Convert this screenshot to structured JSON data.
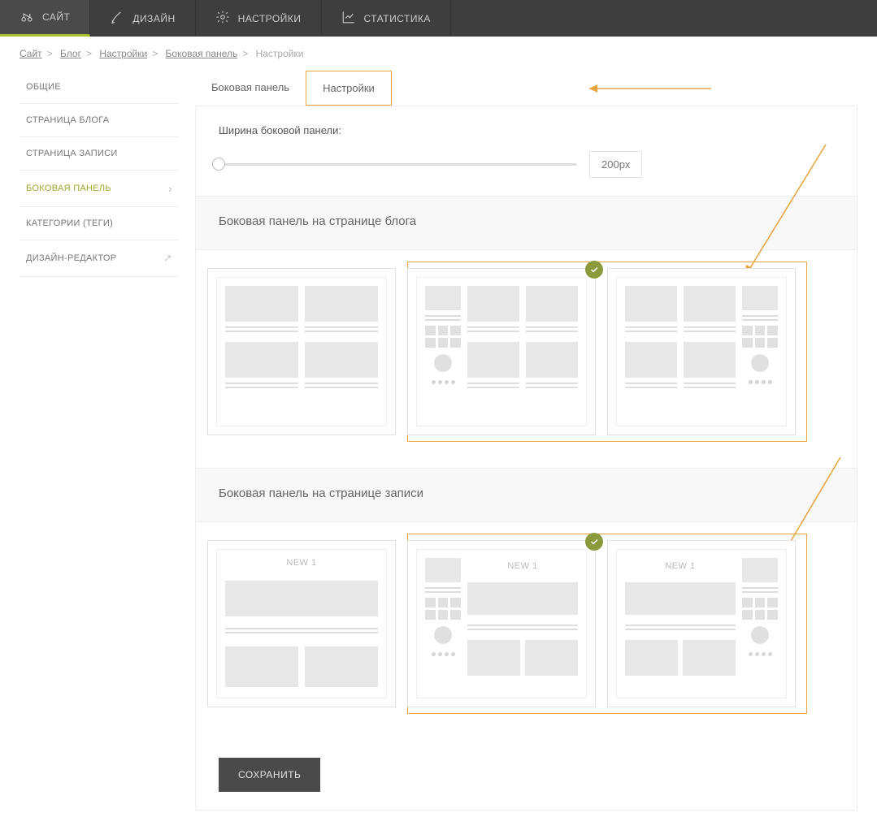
{
  "topnav": {
    "items": [
      {
        "label": "САЙТ"
      },
      {
        "label": "ДИЗАЙН"
      },
      {
        "label": "НАСТРОЙКИ"
      },
      {
        "label": "СТАТИСТИКА"
      }
    ]
  },
  "breadcrumb": {
    "items": [
      "Сайт",
      "Блог",
      "Настройки",
      "Боковая панель",
      "Настройки"
    ]
  },
  "sidemenu": {
    "items": [
      {
        "label": "ОБЩИЕ"
      },
      {
        "label": "СТРАНИЦА БЛОГА"
      },
      {
        "label": "СТРАНИЦА ЗАПИСИ"
      },
      {
        "label": "БОКОВАЯ ПАНЕЛЬ",
        "active": true,
        "chevron": true
      },
      {
        "label": "КАТЕГОРИИ (ТЕГИ)"
      },
      {
        "label": "ДИЗАЙН-РЕДАКТОР",
        "external": true
      }
    ]
  },
  "tabs": {
    "items": [
      {
        "label": "Боковая панель"
      },
      {
        "label": "Настройки",
        "active": true
      }
    ]
  },
  "slider": {
    "label": "Ширина боковой панели:",
    "value": "200px"
  },
  "sections": {
    "blog": {
      "title": "Боковая панель на странице блога"
    },
    "post": {
      "title": "Боковая панель на странице записи",
      "new_label": "NEW 1"
    }
  },
  "buttons": {
    "save": "СОХРАНИТЬ"
  }
}
